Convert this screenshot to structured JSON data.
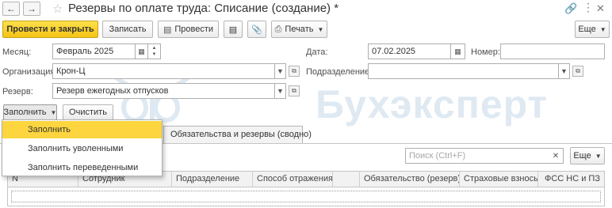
{
  "window": {
    "title": "Резервы по оплате труда: Списание (создание) *"
  },
  "toolbar": {
    "post_and_close": "Провести и закрыть",
    "write": "Записать",
    "post": "Провести",
    "print": "Печать",
    "more": "Еще"
  },
  "form": {
    "month_label": "Месяц:",
    "month_value": "Февраль 2025",
    "date_label": "Дата:",
    "date_value": "07.02.2025",
    "number_label": "Номер:",
    "number_value": "",
    "org_label": "Организация:",
    "org_value": "Крон-Ц",
    "division_label": "Подразделение:",
    "division_value": "",
    "reserve_label": "Резерв:",
    "reserve_value": "Резерв ежегодных отпусков"
  },
  "actions": {
    "fill": "Заполнить",
    "clear": "Очистить"
  },
  "fill_menu": {
    "items": [
      "Заполнить",
      "Заполнить уволенными",
      "Заполнить переведенными"
    ]
  },
  "tabs": {
    "summary": "Обязательства и резервы (сводно)"
  },
  "table_toolbar": {
    "search_placeholder": "Поиск (Ctrl+F)",
    "more": "Еще"
  },
  "table": {
    "columns": [
      "N",
      "Сотрудник",
      "Подразделение",
      "Способ отражения",
      "",
      "Обязательство (резерв)",
      "Страховые взносы",
      "ФСС НС и ПЗ"
    ]
  },
  "watermark": {
    "text": "Бухэксперт"
  }
}
